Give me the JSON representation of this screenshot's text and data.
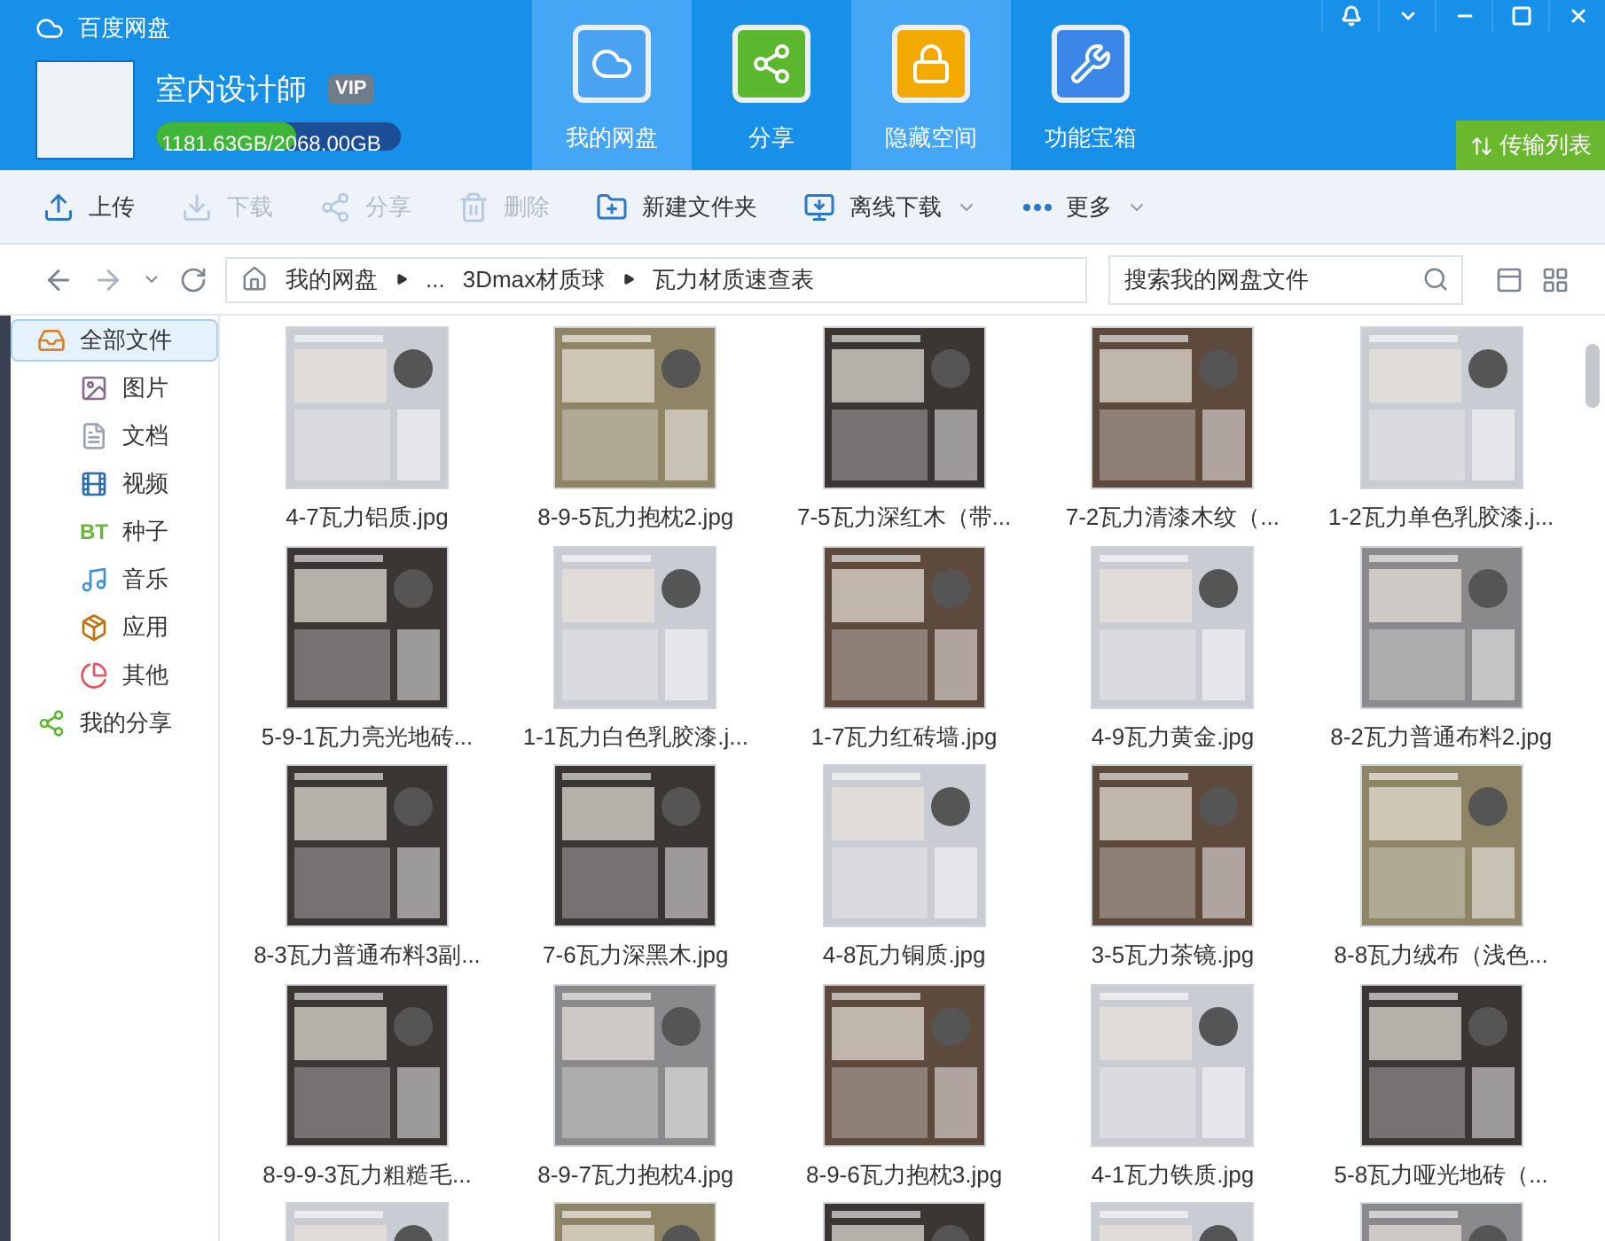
{
  "app": {
    "title": "百度网盘"
  },
  "user": {
    "name": "室内设计師",
    "vip": "VIP",
    "storage": "1181.63GB/2068.00GB",
    "level": 0.571
  },
  "nav_tabs": [
    {
      "label": "我的网盘",
      "selected": true
    },
    {
      "label": "分享",
      "selected": false
    },
    {
      "label": "隐藏空间",
      "selected": true
    },
    {
      "label": "功能宝箱",
      "selected": false
    }
  ],
  "transfer_button": "传输列表",
  "toolbar": [
    {
      "label": "上传",
      "disabled": false,
      "dropdown": false
    },
    {
      "label": "下载",
      "disabled": true,
      "dropdown": false
    },
    {
      "label": "分享",
      "disabled": true,
      "dropdown": false
    },
    {
      "label": "删除",
      "disabled": true,
      "dropdown": false
    },
    {
      "label": "新建文件夹",
      "disabled": false,
      "dropdown": false
    },
    {
      "label": "离线下载",
      "disabled": false,
      "dropdown": true
    },
    {
      "label": "更多",
      "disabled": false,
      "dropdown": true
    }
  ],
  "breadcrumb": [
    "我的网盘",
    "...",
    "3Dmax材质球",
    "瓦力材质速查表"
  ],
  "search": {
    "placeholder": "搜索我的网盘文件"
  },
  "sidebar": [
    {
      "label": "全部文件",
      "selected": true,
      "children": [
        {
          "label": "图片",
          "selected": false
        },
        {
          "label": "文档",
          "selected": false
        },
        {
          "label": "视频",
          "selected": false
        },
        {
          "label": "种子",
          "badge": "BT",
          "selected": false
        },
        {
          "label": "音乐",
          "selected": false
        },
        {
          "label": "应用",
          "selected": false
        },
        {
          "label": "其他",
          "selected": false
        }
      ]
    },
    {
      "label": "我的分享",
      "selected": false
    }
  ],
  "files": [
    {
      "name": "4-7瓦力铝质.jpg"
    },
    {
      "name": "8-9-5瓦力抱枕2.jpg"
    },
    {
      "name": "7-5瓦力深红木（带..."
    },
    {
      "name": "7-2瓦力清漆木纹（..."
    },
    {
      "name": "1-2瓦力单色乳胶漆.j..."
    },
    {
      "name": "5-9-1瓦力亮光地砖..."
    },
    {
      "name": "1-1瓦力白色乳胶漆.j..."
    },
    {
      "name": "1-7瓦力红砖墙.jpg"
    },
    {
      "name": "4-9瓦力黄金.jpg"
    },
    {
      "name": "8-2瓦力普通布料2.jpg"
    },
    {
      "name": "8-3瓦力普通布料3副..."
    },
    {
      "name": "7-6瓦力深黑木.jpg"
    },
    {
      "name": "4-8瓦力铜质.jpg"
    },
    {
      "name": "3-5瓦力茶镜.jpg"
    },
    {
      "name": "8-8瓦力绒布（浅色..."
    },
    {
      "name": "8-9-9-3瓦力粗糙毛..."
    },
    {
      "name": "8-9-7瓦力抱枕4.jpg"
    },
    {
      "name": "8-9-6瓦力抱枕3.jpg"
    },
    {
      "name": "4-1瓦力铁质.jpg"
    },
    {
      "name": "5-8瓦力哑光地砖（..."
    }
  ]
}
